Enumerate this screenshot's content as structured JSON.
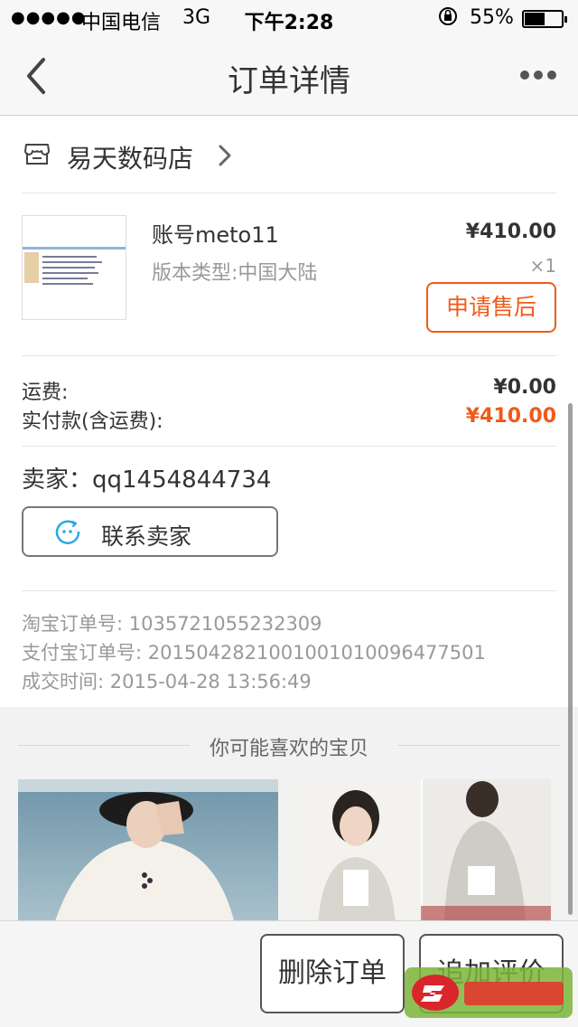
{
  "status_bar": {
    "signal": "●●●●●",
    "carrier": "中国电信",
    "network": "3G",
    "time": "下午2:28",
    "battery_percent": "55%",
    "battery_level": 0.55
  },
  "nav": {
    "title": "订单详情",
    "back_icon": "chevron-left-icon",
    "more_icon": "more-dots-icon"
  },
  "shop": {
    "name": "易天数码店",
    "icon": "store-icon"
  },
  "product": {
    "name": "账号meto11",
    "spec": "版本类型:中国大陆",
    "price": "¥410.00",
    "qty": "×1",
    "after_sale_label": "申请售后"
  },
  "totals": {
    "shipping_label": "运费:",
    "shipping_value": "¥0.00",
    "paid_label": "实付款(含运费):",
    "paid_value": "¥410.00"
  },
  "seller": {
    "label": "卖家：qq1454844734",
    "contact_label": "联系卖家"
  },
  "order_info": {
    "taobao_order": "淘宝订单号: 1035721055232309",
    "alipay_order": "支付宝订单号: 2015042821001001010096477501",
    "deal_time": "成交时间: 2015-04-28 13:56:49"
  },
  "recommend": {
    "title": "你可能喜欢的宝贝"
  },
  "bottom": {
    "delete_label": "删除订单",
    "review_label": "追加评价"
  },
  "colors": {
    "accent": "#f05a1a",
    "chat_icon": "#2aa7e8"
  }
}
